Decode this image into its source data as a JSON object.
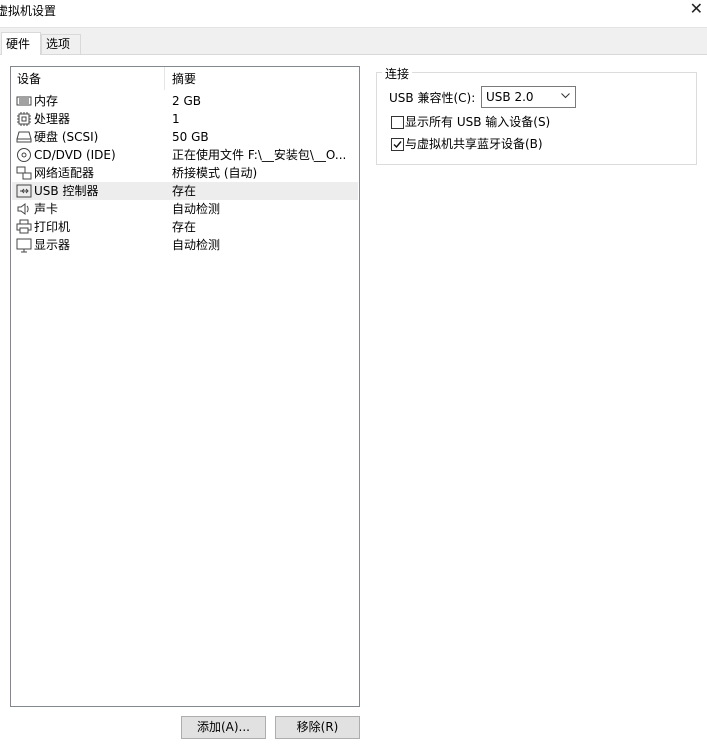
{
  "window": {
    "title": "虚拟机设置",
    "close_glyph": "✕"
  },
  "tabs": [
    {
      "label": "硬件",
      "active": true
    },
    {
      "label": "选项",
      "active": false
    }
  ],
  "device_list": {
    "headers": {
      "device": "设备",
      "summary": "摘要"
    },
    "rows": [
      {
        "name": "内存",
        "summary": "2 GB",
        "icon": "memory-icon"
      },
      {
        "name": "处理器",
        "summary": "1",
        "icon": "processor-icon"
      },
      {
        "name": "硬盘 (SCSI)",
        "summary": "50 GB",
        "icon": "hard-disk-icon"
      },
      {
        "name": "CD/DVD (IDE)",
        "summary": "正在使用文件 F:\\__安装包\\__O...",
        "icon": "cd-dvd-icon"
      },
      {
        "name": "网络适配器",
        "summary": "桥接模式 (自动)",
        "icon": "network-adapter-icon"
      },
      {
        "name": "USB 控制器",
        "summary": "存在",
        "icon": "usb-icon",
        "selected": true
      },
      {
        "name": "声卡",
        "summary": "自动检测",
        "icon": "sound-card-icon"
      },
      {
        "name": "打印机",
        "summary": "存在",
        "icon": "printer-icon"
      },
      {
        "name": "显示器",
        "summary": "自动检测",
        "icon": "display-icon"
      }
    ]
  },
  "buttons": {
    "add": "添加(A)...",
    "remove": "移除(R)"
  },
  "connection": {
    "group_label": "连接",
    "compat_label": "USB 兼容性(C):",
    "compat_value": "USB 2.0",
    "show_all_usb": {
      "label": "显示所有 USB 输入设备(S)",
      "checked": false
    },
    "share_bluetooth": {
      "label": "与虚拟机共享蓝牙设备(B)",
      "checked": true
    }
  }
}
